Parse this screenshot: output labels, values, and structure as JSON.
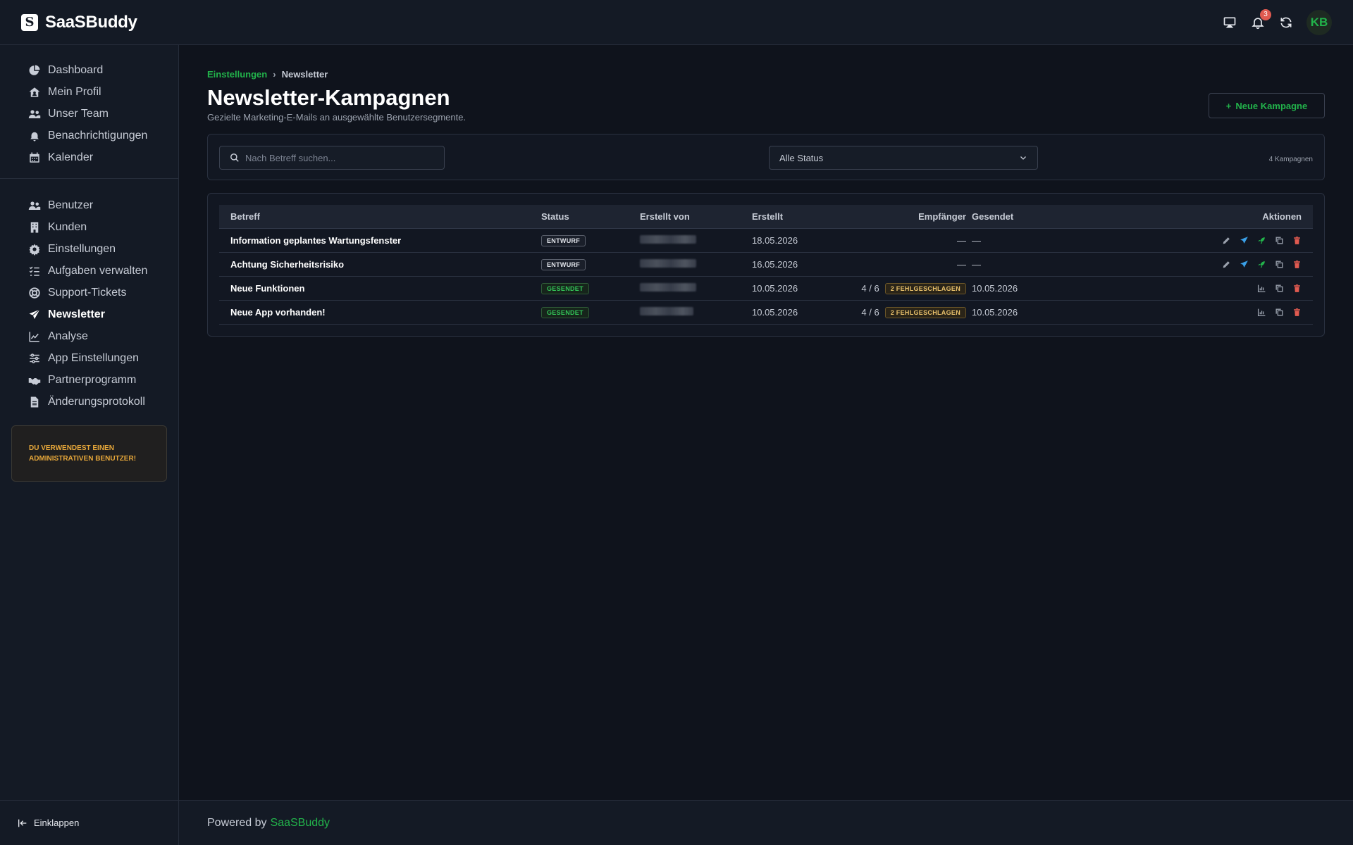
{
  "app": {
    "name": "SaaSBuddy",
    "logo_letter": "S"
  },
  "topbar": {
    "icons": [
      "cast-icon",
      "bell-icon",
      "refresh-icon"
    ],
    "notification_count": "3",
    "avatar_initials": "KB"
  },
  "sidebar": {
    "group1": [
      {
        "label": "Dashboard",
        "icon": "pie-chart-icon"
      },
      {
        "label": "Mein Profil",
        "icon": "home-user-icon"
      },
      {
        "label": "Unser Team",
        "icon": "users-icon"
      },
      {
        "label": "Benachrichtigungen",
        "icon": "bell-icon"
      },
      {
        "label": "Kalender",
        "icon": "calendar-icon"
      }
    ],
    "group2": [
      {
        "label": "Benutzer",
        "icon": "users-icon"
      },
      {
        "label": "Kunden",
        "icon": "building-icon"
      },
      {
        "label": "Einstellungen",
        "icon": "gear-icon"
      },
      {
        "label": "Aufgaben verwalten",
        "icon": "list-check-icon"
      },
      {
        "label": "Support-Tickets",
        "icon": "lifebuoy-icon"
      },
      {
        "label": "Newsletter",
        "icon": "paper-plane-icon",
        "active": true
      },
      {
        "label": "Analyse",
        "icon": "line-chart-icon"
      },
      {
        "label": "App Einstellungen",
        "icon": "sliders-icon"
      },
      {
        "label": "Partnerprogramm",
        "icon": "handshake-icon"
      },
      {
        "label": "Änderungsprotokoll",
        "icon": "file-icon"
      }
    ],
    "admin_notice": "DU VERWENDEST EINEN ADMINISTRATIVEN BENUTZER!",
    "collapse_label": "Einklappen"
  },
  "breadcrumb": {
    "parent": "Einstellungen",
    "separator": "›",
    "current": "Newsletter"
  },
  "page": {
    "title": "Newsletter-Kampagnen",
    "subtitle": "Gezielte Marketing-E-Mails an ausgewählte Benutzersegmente.",
    "new_button": "Neue Kampagne",
    "new_button_prefix": "+"
  },
  "filters": {
    "search_placeholder": "Nach Betreff suchen...",
    "status_value": "Alle Status",
    "count_label": "4 Kampagnen"
  },
  "table": {
    "headers": {
      "subject": "Betreff",
      "status": "Status",
      "created_by": "Erstellt von",
      "created": "Erstellt",
      "recipients": "Empfänger",
      "sent": "Gesendet",
      "actions": "Aktionen"
    },
    "rows": [
      {
        "subject": "Information geplantes Wartungsfenster",
        "status": "ENTWURF",
        "status_kind": "draft",
        "created": "18.05.2026",
        "recipients": "—",
        "failed": "",
        "sent": "—"
      },
      {
        "subject": "Achtung Sicherheitsrisiko",
        "status": "ENTWURF",
        "status_kind": "draft",
        "created": "16.05.2026",
        "recipients": "—",
        "failed": "",
        "sent": "—"
      },
      {
        "subject": "Neue Funktionen",
        "status": "GESENDET",
        "status_kind": "sent",
        "created": "10.05.2026",
        "recipients": "4 / 6",
        "failed": "2 FEHLGESCHLAGEN",
        "sent": "10.05.2026"
      },
      {
        "subject": "Neue App vorhanden!",
        "status": "GESENDET",
        "status_kind": "sent",
        "created": "10.05.2026",
        "recipients": "4 / 6",
        "failed": "2 FEHLGESCHLAGEN",
        "sent": "10.05.2026"
      }
    ]
  },
  "footer": {
    "prefix": "Powered by",
    "brand": "SaaSBuddy"
  },
  "colors": {
    "accent": "#22b34b",
    "warning": "#e8a83a",
    "danger": "#e05a50",
    "info": "#3aa0e8"
  }
}
